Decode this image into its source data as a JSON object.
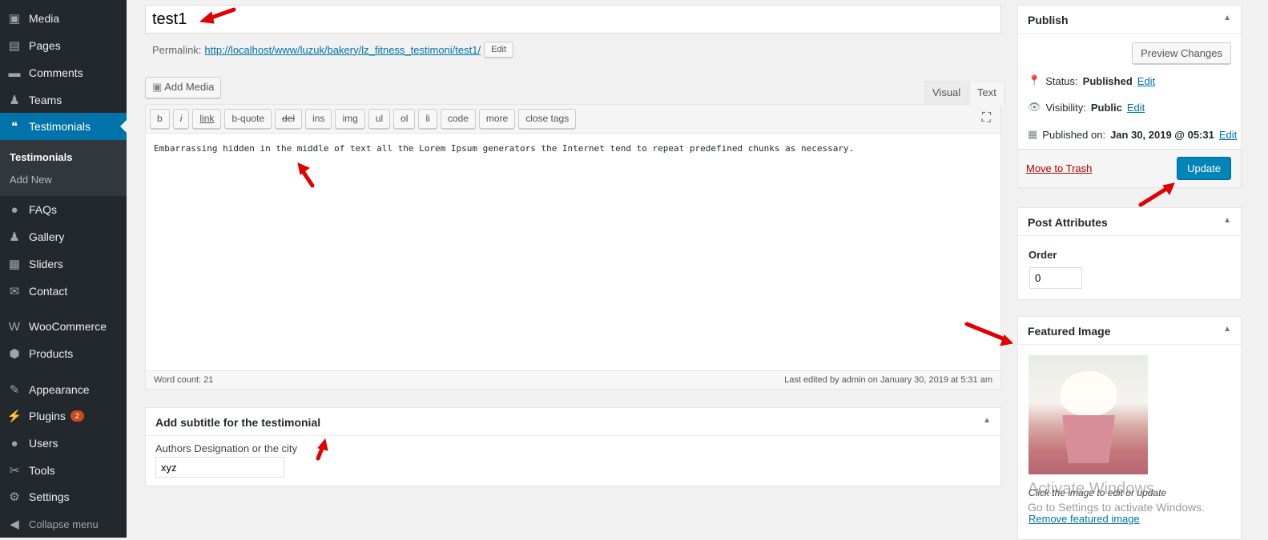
{
  "sidebar": {
    "items": [
      {
        "label": "Media",
        "icon": "media-icon"
      },
      {
        "label": "Pages",
        "icon": "pages-icon"
      },
      {
        "label": "Comments",
        "icon": "comments-icon"
      },
      {
        "label": "Teams",
        "icon": "teams-icon"
      },
      {
        "label": "Testimonials",
        "icon": "testimonials-icon"
      },
      {
        "label": "FAQs",
        "icon": "faqs-icon"
      },
      {
        "label": "Gallery",
        "icon": "gallery-icon"
      },
      {
        "label": "Sliders",
        "icon": "sliders-icon"
      },
      {
        "label": "Contact",
        "icon": "contact-icon"
      },
      {
        "label": "WooCommerce",
        "icon": "woocommerce-icon"
      },
      {
        "label": "Products",
        "icon": "products-icon"
      },
      {
        "label": "Appearance",
        "icon": "appearance-icon"
      },
      {
        "label": "Plugins",
        "icon": "plugins-icon",
        "badge": "2"
      },
      {
        "label": "Users",
        "icon": "users-icon"
      },
      {
        "label": "Tools",
        "icon": "tools-icon"
      },
      {
        "label": "Settings",
        "icon": "settings-icon"
      },
      {
        "label": "Collapse menu",
        "icon": "collapse-icon"
      }
    ],
    "submenu": [
      "Testimonials",
      "Add New"
    ]
  },
  "post": {
    "title": "test1",
    "permalink_label": "Permalink:",
    "permalink": "http://localhost/www/luzuk/bakery/lz_fitness_testimoni/test1/",
    "edit": "Edit"
  },
  "editor": {
    "add_media": "Add Media",
    "tab_visual": "Visual",
    "tab_text": "Text",
    "quicktags": [
      "b",
      "i",
      "link",
      "b-quote",
      "del",
      "ins",
      "img",
      "ul",
      "ol",
      "li",
      "code",
      "more",
      "close tags"
    ],
    "content": "Embarrassing hidden in the middle of text all the Lorem Ipsum generators the Internet tend to repeat predefined chunks as necessary.",
    "word_count": "Word count: 21",
    "last_edited": "Last edited by admin on January 30, 2019 at 5:31 am"
  },
  "subtitle_box": {
    "title": "Add subtitle for the testimonial",
    "label": "Authors Designation or the city",
    "value": "xyz"
  },
  "publish": {
    "title": "Publish",
    "preview": "Preview Changes",
    "status_label": "Status:",
    "status": "Published",
    "visibility_label": "Visibility:",
    "visibility": "Public",
    "published_label": "Published on:",
    "published": "Jan 30, 2019 @ 05:31",
    "edit": "Edit",
    "trash": "Move to Trash",
    "update": "Update"
  },
  "attributes": {
    "title": "Post Attributes",
    "order_label": "Order",
    "order": "0"
  },
  "featured": {
    "title": "Featured Image",
    "hint": "Click the image to edit or update",
    "remove": "Remove featured image"
  },
  "watermark": {
    "line1": "Activate Windows",
    "line2": "Go to Settings to activate Windows."
  },
  "colors": {
    "accent": "#0073aa",
    "sidebar": "#23282d",
    "arrows": "#e00000"
  }
}
